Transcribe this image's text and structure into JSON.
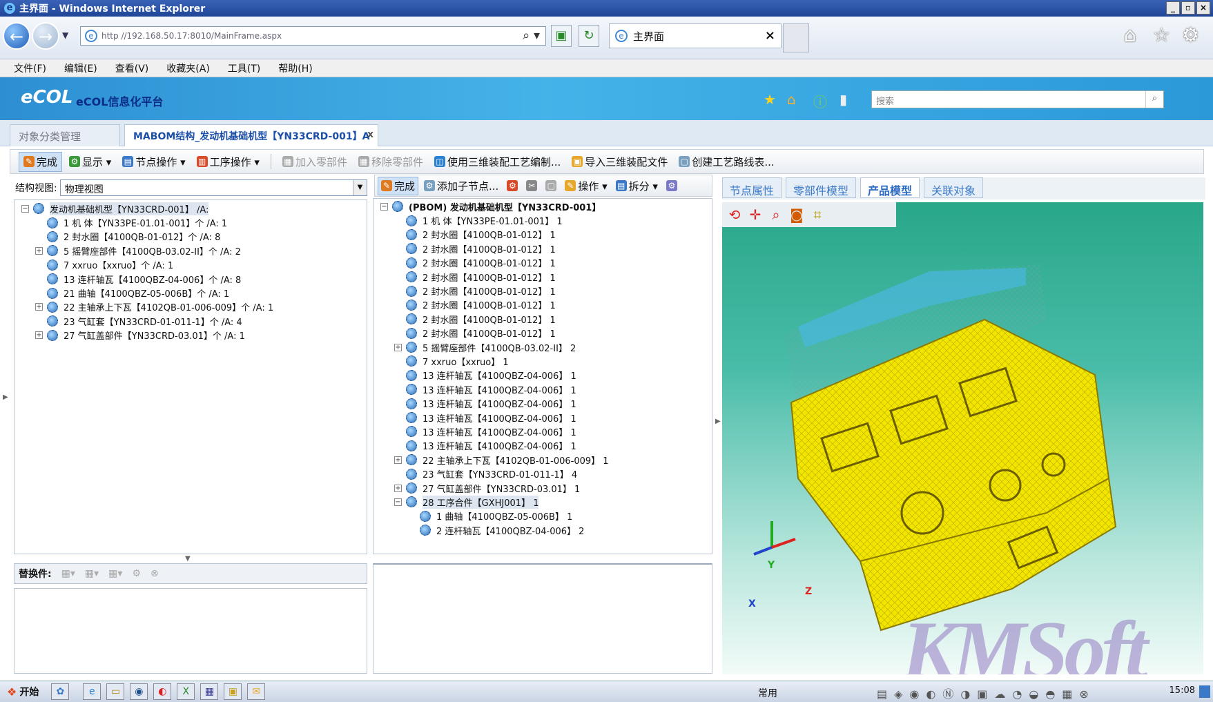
{
  "window": {
    "title": "主界面 - Windows Internet Explorer",
    "min": "_",
    "max": "▫",
    "close": "×"
  },
  "browser": {
    "address": "http //192.168.50.17:8010/MainFrame.aspx",
    "tab_title": "主界面",
    "tab_close": "×",
    "search_placeholder": "搜索"
  },
  "menu": [
    "文件(F)",
    "编辑(E)",
    "查看(V)",
    "收藏夹(A)",
    "工具(T)",
    "帮助(H)"
  ],
  "banner": {
    "logo": "eCOL",
    "platform": "eCOL信息化平台"
  },
  "page_tabs": [
    {
      "label": "对象分类管理"
    },
    {
      "label": "MABOM结构_发动机基础机型【YN33CRD-001】A",
      "close": "x"
    }
  ],
  "toolbar": [
    {
      "label": "完成",
      "icon": "✎",
      "color": "#e07a20"
    },
    {
      "label": "显示 ▾",
      "icon": "⚙",
      "color": "#3a9a3a"
    },
    {
      "label": "节点操作 ▾",
      "icon": "▤",
      "color": "#3a78c8"
    },
    {
      "label": "工序操作 ▾",
      "icon": "▥",
      "color": "#d84a2a"
    },
    {
      "label": "加入零部件",
      "icon": "▦",
      "color": "#aaaaaa"
    },
    {
      "label": "移除零部件",
      "icon": "▦",
      "color": "#aaaaaa"
    },
    {
      "label": "使用三维装配工艺编制...",
      "icon": "◫",
      "color": "#2a80d0"
    },
    {
      "label": "导入三维装配文件",
      "icon": "▣",
      "color": "#e6a72a"
    },
    {
      "label": "创建工艺路线表...",
      "icon": "▢",
      "color": "#7aa0c0"
    }
  ],
  "left": {
    "view_label": "结构视图:",
    "view_value": "物理视图",
    "tree": [
      {
        "text": "发动机基础机型【YN33CRD-001】 /A:",
        "depth": 0,
        "toggle": "−"
      },
      {
        "text": "1 机 体【YN33PE-01.01-001】个 /A: 1",
        "depth": 1,
        "toggle": ""
      },
      {
        "text": "2 封水圈【4100QB-01-012】个 /A: 8",
        "depth": 1,
        "toggle": ""
      },
      {
        "text": "5 摇臂座部件【4100QB-03.02-II】个 /A: 2",
        "depth": 1,
        "toggle": "+"
      },
      {
        "text": "7 xxruo【xxruo】个 /A: 1",
        "depth": 1,
        "toggle": ""
      },
      {
        "text": "13 连杆轴瓦【4100QBZ-04-006】个 /A: 8",
        "depth": 1,
        "toggle": ""
      },
      {
        "text": "21 曲轴【4100QBZ-05-006B】个 /A: 1",
        "depth": 1,
        "toggle": ""
      },
      {
        "text": "22 主轴承上下瓦【4102QB-01-006-009】个 /A: 1",
        "depth": 1,
        "toggle": "+"
      },
      {
        "text": "23 气缸套【YN33CRD-01-011-1】个 /A: 4",
        "depth": 1,
        "toggle": ""
      },
      {
        "text": "27 气缸盖部件【YN33CRD-03.01】个 /A: 1",
        "depth": 1,
        "toggle": "+"
      }
    ],
    "replace_label": "替换件:"
  },
  "middle": {
    "toolbar": [
      {
        "label": "完成",
        "icon": "✎",
        "color": "#e07a20"
      },
      {
        "label": "添加子节点...",
        "icon": "⚙",
        "color": "#7aa0c0"
      },
      {
        "label": "",
        "icon": "⚙",
        "color": "#d84a2a"
      },
      {
        "label": "",
        "icon": "✂",
        "color": "#888888"
      },
      {
        "label": "",
        "icon": "▢",
        "color": "#aaaaaa"
      },
      {
        "label": "操作 ▾",
        "icon": "✎",
        "color": "#e6a72a"
      },
      {
        "label": "拆分 ▾",
        "icon": "▤",
        "color": "#3a78c8"
      },
      {
        "label": "",
        "icon": "⚙",
        "color": "#7a7ac8"
      }
    ],
    "tree": [
      {
        "text": "(PBOM) 发动机基础机型【YN33CRD-001】",
        "depth": 0,
        "toggle": "−",
        "bold": true
      },
      {
        "text": "1 机 体【YN33PE-01.01-001】 1",
        "depth": 1,
        "toggle": ""
      },
      {
        "text": "2 封水圈【4100QB-01-012】 1",
        "depth": 1,
        "toggle": ""
      },
      {
        "text": "2 封水圈【4100QB-01-012】 1",
        "depth": 1,
        "toggle": ""
      },
      {
        "text": "2 封水圈【4100QB-01-012】 1",
        "depth": 1,
        "toggle": ""
      },
      {
        "text": "2 封水圈【4100QB-01-012】 1",
        "depth": 1,
        "toggle": ""
      },
      {
        "text": "2 封水圈【4100QB-01-012】 1",
        "depth": 1,
        "toggle": ""
      },
      {
        "text": "2 封水圈【4100QB-01-012】 1",
        "depth": 1,
        "toggle": ""
      },
      {
        "text": "2 封水圈【4100QB-01-012】 1",
        "depth": 1,
        "toggle": ""
      },
      {
        "text": "2 封水圈【4100QB-01-012】 1",
        "depth": 1,
        "toggle": ""
      },
      {
        "text": "5 摇臂座部件【4100QB-03.02-II】 2",
        "depth": 1,
        "toggle": "+"
      },
      {
        "text": "7 xxruo【xxruo】 1",
        "depth": 1,
        "toggle": ""
      },
      {
        "text": "13 连杆轴瓦【4100QBZ-04-006】 1",
        "depth": 1,
        "toggle": ""
      },
      {
        "text": "13 连杆轴瓦【4100QBZ-04-006】 1",
        "depth": 1,
        "toggle": ""
      },
      {
        "text": "13 连杆轴瓦【4100QBZ-04-006】 1",
        "depth": 1,
        "toggle": ""
      },
      {
        "text": "13 连杆轴瓦【4100QBZ-04-006】 1",
        "depth": 1,
        "toggle": ""
      },
      {
        "text": "13 连杆轴瓦【4100QBZ-04-006】 1",
        "depth": 1,
        "toggle": ""
      },
      {
        "text": "13 连杆轴瓦【4100QBZ-04-006】 1",
        "depth": 1,
        "toggle": ""
      },
      {
        "text": "22 主轴承上下瓦【4102QB-01-006-009】 1",
        "depth": 1,
        "toggle": "+"
      },
      {
        "text": "23 气缸套【YN33CRD-01-011-1】 4",
        "depth": 1,
        "toggle": ""
      },
      {
        "text": "27 气缸盖部件【YN33CRD-03.01】 1",
        "depth": 1,
        "toggle": "+"
      },
      {
        "text": "28 工序合件【GXHJ001】 1",
        "depth": 1,
        "toggle": "−",
        "selected": true
      },
      {
        "text": "1 曲轴【4100QBZ-05-006B】 1",
        "depth": 2,
        "toggle": ""
      },
      {
        "text": "2 连杆轴瓦【4100QBZ-04-006】 2",
        "depth": 2,
        "toggle": ""
      }
    ]
  },
  "right": {
    "tabs": [
      "节点属性",
      "零部件模型",
      "产品模型",
      "关联对象"
    ],
    "active_tab": 2,
    "axes": {
      "x": "X",
      "y": "Y",
      "z": "Z"
    },
    "watermark": "KMSoft"
  },
  "taskbar": {
    "start": "开始",
    "center": "常用",
    "clock": "15:08"
  },
  "colors": {
    "banner": "#2d8fd2",
    "model": "#f2e600",
    "viewport": "#29a789"
  }
}
